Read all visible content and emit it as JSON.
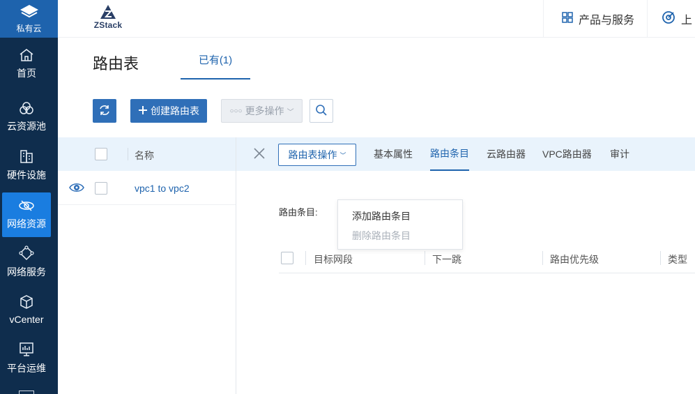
{
  "sidebar": {
    "brand_label": "私有云",
    "items": [
      {
        "label": "首页",
        "icon": "home-icon"
      },
      {
        "label": "云资源池",
        "icon": "resource-pool-icon"
      },
      {
        "label": "硬件设施",
        "icon": "hardware-icon"
      },
      {
        "label": "网络资源",
        "icon": "network-icon",
        "active": true
      },
      {
        "label": "网络服务",
        "icon": "network-service-icon"
      },
      {
        "label": "vCenter",
        "icon": "cube-icon"
      },
      {
        "label": "平台运维",
        "icon": "monitor-icon"
      }
    ]
  },
  "topbar": {
    "logo_text": "ZStack",
    "products_label": "产品与服务",
    "upload_label": "上"
  },
  "page": {
    "title": "路由表",
    "tab_label": "已有(1)"
  },
  "toolbar": {
    "create_label": "创建路由表",
    "more_label": "更多操作"
  },
  "list": {
    "header_name": "名称",
    "rows": [
      {
        "name": "vpc1 to vpc2"
      }
    ]
  },
  "detail": {
    "op_dropdown_label": "路由表操作",
    "tabs": [
      "基本属性",
      "路由条目",
      "云路由器",
      "VPC路由器",
      "审计"
    ],
    "active_tab": "路由条目",
    "route_label": "路由条目:",
    "menu_items": [
      {
        "label": "添加路由条目",
        "enabled": true
      },
      {
        "label": "删除路由条目",
        "enabled": false
      }
    ],
    "table_headers": [
      "目标网段",
      "下一跳",
      "路由优先级",
      "类型"
    ]
  },
  "colors": {
    "nav_bg": "#0f2d4d",
    "brand_blue": "#1e63ad",
    "active_nav": "#1a7de0",
    "button_blue": "#2f6fb8",
    "header_bg": "#e9f3fc"
  }
}
